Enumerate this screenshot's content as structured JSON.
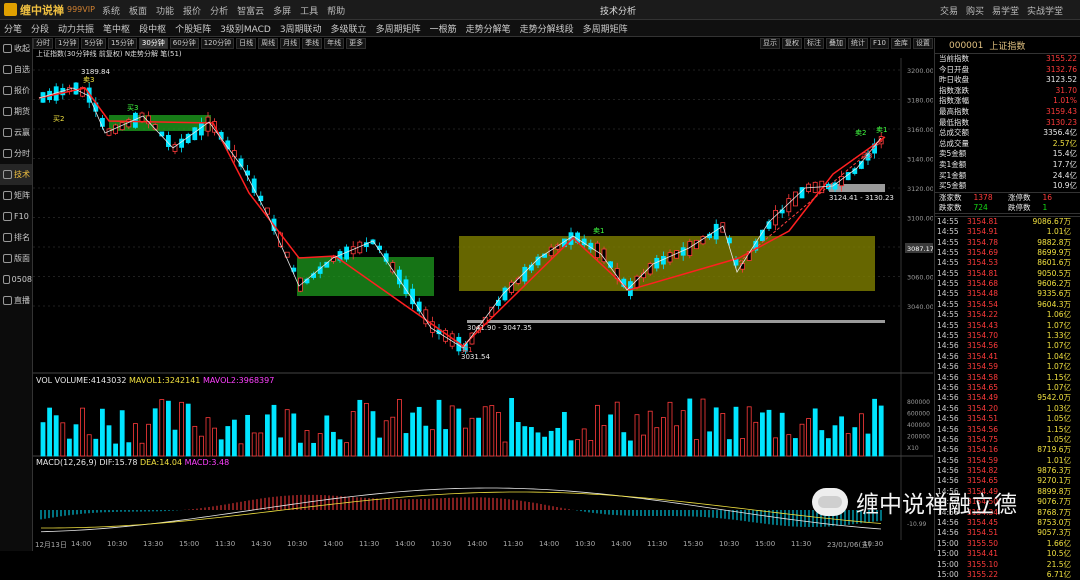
{
  "app": {
    "name": "缠中说禅",
    "version": "999VIP",
    "window_title": "技术分析"
  },
  "main_menu": [
    "系统",
    "板面",
    "功能",
    "报价",
    "分析",
    "智富云",
    "多屏",
    "工具",
    "帮助"
  ],
  "right_menu": [
    "交易",
    "购买",
    "易学堂",
    "实战学堂"
  ],
  "toolbar": [
    "分笔",
    "分段",
    "动力共振",
    "笔中枢",
    "段中枢",
    "个股矩阵",
    "3级别MACD",
    "3周期联动",
    "多级联立",
    "多周期矩阵",
    "一根筋",
    "走势分解笔",
    "走势分解线段",
    "多周期矩阵"
  ],
  "left_nav": [
    "收起",
    "自选",
    "报价",
    "期货",
    "云赢",
    "分时",
    "技术",
    "矩阵",
    "F10",
    "排名",
    "版面",
    "0508",
    "直播"
  ],
  "left_nav_active": "技术",
  "periods": [
    "分时",
    "1分钟",
    "5分钟",
    "15分钟",
    "30分钟",
    "60分钟",
    "120分钟",
    "日线",
    "周线",
    "月线",
    "季线",
    "年线",
    "更多"
  ],
  "period_active": "30分钟",
  "right_tools": [
    "显示",
    "复权",
    "标注",
    "叠加",
    "统计",
    "F10",
    "金库",
    "设置"
  ],
  "chart_info": "上证指数(30分钟线 前复权)  N走势分解  笔(51)",
  "price_axis": [
    "3200.00",
    "3180.00",
    "3160.00",
    "3140.00",
    "3120.00",
    "3100.00",
    "3080.00",
    "3060.00",
    "3040.00"
  ],
  "price_marker": "3087.17",
  "annotations": {
    "high": "3189.84",
    "low": "3031.54",
    "range1": "3041.90 - 3047.35",
    "range2": "3124.41 - 3130.23",
    "labels": [
      "卖3",
      "买1",
      "买2",
      "卖1",
      "卖2",
      "买3",
      "卖1",
      "买3"
    ]
  },
  "volume": {
    "label": "VOL",
    "volume": "VOLUME:4143032",
    "mavol1": "MAVOL1:3242141",
    "mavol2": "MAVOL2:3968397",
    "axis": [
      "800000",
      "600000",
      "400000",
      "200000",
      "X10"
    ]
  },
  "macd": {
    "label": "MACD(12,26,9)",
    "dif": "DIF:15.78",
    "dea": "DEA:14.04",
    "macd": "MACD:3.48",
    "axis_low": "-10.99"
  },
  "time_axis": [
    "12月13日",
    "14:00",
    "10:30",
    "13:30",
    "15:00",
    "11:30",
    "14:30",
    "10:30",
    "14:00",
    "11:30",
    "14:00",
    "10:30",
    "14:00",
    "11:30",
    "14:00",
    "10:30",
    "14:00",
    "11:30",
    "15:30",
    "10:30",
    "15:00",
    "11:30",
    "23/01/06(五)",
    "10:30"
  ],
  "stock": {
    "code": "000001",
    "name": "上证指数"
  },
  "quote": [
    {
      "label": "当前指数",
      "value": "3155.22",
      "cls": "red"
    },
    {
      "label": "今日开盘",
      "value": "3132.76",
      "cls": "red"
    },
    {
      "label": "昨日收盘",
      "value": "3123.52",
      "cls": "white"
    },
    {
      "label": "指数涨跌",
      "value": "31.70",
      "cls": "red"
    },
    {
      "label": "指数涨幅",
      "value": "1.01%",
      "cls": "red"
    },
    {
      "label": "最高指数",
      "value": "3159.43",
      "cls": "red"
    },
    {
      "label": "最低指数",
      "value": "3130.23",
      "cls": "red"
    },
    {
      "label": "总成交额",
      "value": "3356.4亿",
      "cls": "white"
    },
    {
      "label": "总成交量",
      "value": "2.57亿",
      "cls": "yellow"
    },
    {
      "label": "卖5金额",
      "value": "15.4亿",
      "cls": "white"
    },
    {
      "label": "卖1金额",
      "value": "17.7亿",
      "cls": "white"
    },
    {
      "label": "买1金额",
      "value": "24.4亿",
      "cls": "white"
    },
    {
      "label": "买5金额",
      "value": "10.9亿",
      "cls": "white"
    }
  ],
  "stats": [
    {
      "a": "涨家数",
      "b": "1378",
      "c": "涨停数",
      "d": "16"
    },
    {
      "a": "跌家数",
      "b": "724",
      "c": "跌停数",
      "d": "1"
    }
  ],
  "ticks": [
    {
      "t": "14:55",
      "p": "3154.81",
      "v": "9086.67万"
    },
    {
      "t": "14:55",
      "p": "3154.91",
      "v": "1.01亿"
    },
    {
      "t": "14:55",
      "p": "3154.78",
      "v": "9882.8万"
    },
    {
      "t": "14:55",
      "p": "3154.69",
      "v": "8699.9万"
    },
    {
      "t": "14:55",
      "p": "3154.53",
      "v": "8601.6万"
    },
    {
      "t": "14:55",
      "p": "3154.81",
      "v": "9050.5万"
    },
    {
      "t": "14:55",
      "p": "3154.68",
      "v": "9606.2万"
    },
    {
      "t": "14:55",
      "p": "3154.48",
      "v": "9335.6万"
    },
    {
      "t": "14:55",
      "p": "3154.54",
      "v": "9604.3万"
    },
    {
      "t": "14:55",
      "p": "3154.22",
      "v": "1.06亿"
    },
    {
      "t": "14:55",
      "p": "3154.43",
      "v": "1.07亿"
    },
    {
      "t": "14:55",
      "p": "3154.70",
      "v": "1.33亿"
    },
    {
      "t": "14:56",
      "p": "3154.56",
      "v": "1.07亿"
    },
    {
      "t": "14:56",
      "p": "3154.41",
      "v": "1.04亿"
    },
    {
      "t": "14:56",
      "p": "3154.59",
      "v": "1.07亿"
    },
    {
      "t": "14:56",
      "p": "3154.58",
      "v": "1.15亿"
    },
    {
      "t": "14:56",
      "p": "3154.65",
      "v": "1.07亿"
    },
    {
      "t": "14:56",
      "p": "3154.49",
      "v": "9542.0万"
    },
    {
      "t": "14:56",
      "p": "3154.20",
      "v": "1.03亿"
    },
    {
      "t": "14:56",
      "p": "3154.51",
      "v": "1.05亿"
    },
    {
      "t": "14:56",
      "p": "3154.56",
      "v": "1.15亿"
    },
    {
      "t": "14:56",
      "p": "3154.75",
      "v": "1.05亿"
    },
    {
      "t": "14:56",
      "p": "3154.16",
      "v": "8719.6万"
    },
    {
      "t": "14:56",
      "p": "3154.59",
      "v": "1.01亿"
    },
    {
      "t": "14:56",
      "p": "3154.82",
      "v": "9876.3万"
    },
    {
      "t": "14:56",
      "p": "3154.65",
      "v": "9270.1万"
    },
    {
      "t": "14:56",
      "p": "3154.49",
      "v": "8899.8万"
    },
    {
      "t": "14:56",
      "p": "3154.50",
      "v": "9076.7万"
    },
    {
      "t": "14:56",
      "p": "3154.34",
      "v": "8768.7万"
    },
    {
      "t": "14:56",
      "p": "3154.45",
      "v": "8753.0万"
    },
    {
      "t": "14:56",
      "p": "3154.51",
      "v": "9057.3万"
    },
    {
      "t": "15:00",
      "p": "3155.50",
      "v": "1.66亿"
    },
    {
      "t": "15:00",
      "p": "3154.41",
      "v": "10.5亿"
    },
    {
      "t": "15:00",
      "p": "3155.10",
      "v": "21.5亿"
    },
    {
      "t": "15:00",
      "p": "3155.22",
      "v": "6.71亿"
    }
  ],
  "watermark": "缠中说禅融立德",
  "colors": {
    "up": "#ff3b3b",
    "down": "#00e5ff",
    "zone_green": "#1fa51f",
    "zone_yellow": "#8a8a00",
    "accent": "#f0c040"
  }
}
